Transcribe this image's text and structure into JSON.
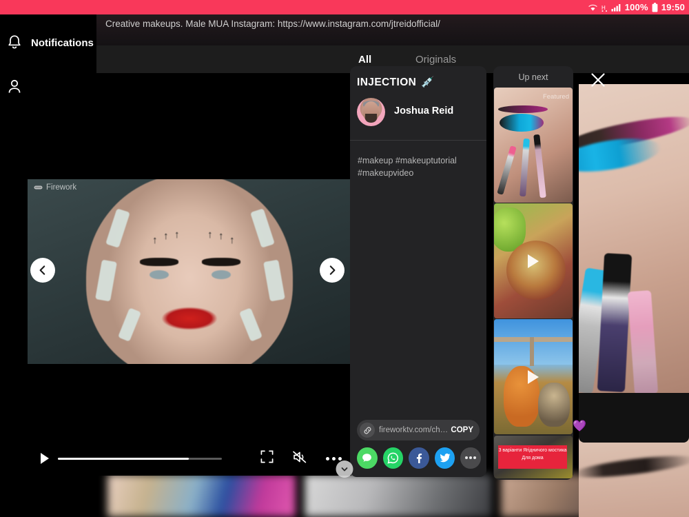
{
  "statusbar": {
    "battery_percent": "100%",
    "time": "19:50",
    "icons": [
      "wifi-icon",
      "signal-h-icon",
      "cellular-signal-icon",
      "battery-icon"
    ],
    "accent_color": "#f9385a"
  },
  "sidebar": {
    "items": [
      {
        "icon": "bell-icon",
        "label": "Notifications"
      },
      {
        "icon": "person-icon",
        "label": ""
      }
    ]
  },
  "channel": {
    "description": "Creative makeups. Male MUA Instagram: https://www.instagram.com/jtreidofficial/",
    "tabs": [
      {
        "label": "All",
        "active": true
      },
      {
        "label": "Originals",
        "active": false
      }
    ]
  },
  "player": {
    "watermark": "Firework",
    "prev_icon": "chevron-left-icon",
    "next_icon": "chevron-right-icon",
    "play_icon": "play-icon",
    "fullscreen_icon": "fullscreen-icon",
    "mute_icon": "volume-muted-icon",
    "more_icon": "more-options-icon",
    "progress_percent": 80
  },
  "video_info": {
    "title": "INJECTION",
    "title_emoji": "💉",
    "author": "Joshua Reid",
    "tags": "#makeup #makeuptutorial #makeupvideo"
  },
  "share": {
    "link_icon": "link-icon",
    "link_url": "fireworktv.com/ch…",
    "copy_label": "COPY",
    "targets": [
      {
        "name": "sms-share-icon",
        "color": "#4cd964"
      },
      {
        "name": "whatsapp-share-icon",
        "color": "#25d366"
      },
      {
        "name": "facebook-share-icon",
        "color": "#3b5998"
      },
      {
        "name": "twitter-share-icon",
        "color": "#1da1f2"
      },
      {
        "name": "more-share-icon",
        "color": "#4a4a4c"
      }
    ]
  },
  "up_next": {
    "title": "Up next",
    "items": [
      {
        "badge": "Featured",
        "has_play": false
      },
      {
        "badge": "",
        "has_play": true
      },
      {
        "badge": "",
        "has_play": true
      },
      {
        "badge": "3 варіанти Ягідничого мостика Для дома",
        "has_play": false
      }
    ],
    "scroll_icon": "chevron-down-icon"
  },
  "right_panel": {
    "close_icon": "close-icon",
    "reaction_emoji": "💜"
  }
}
